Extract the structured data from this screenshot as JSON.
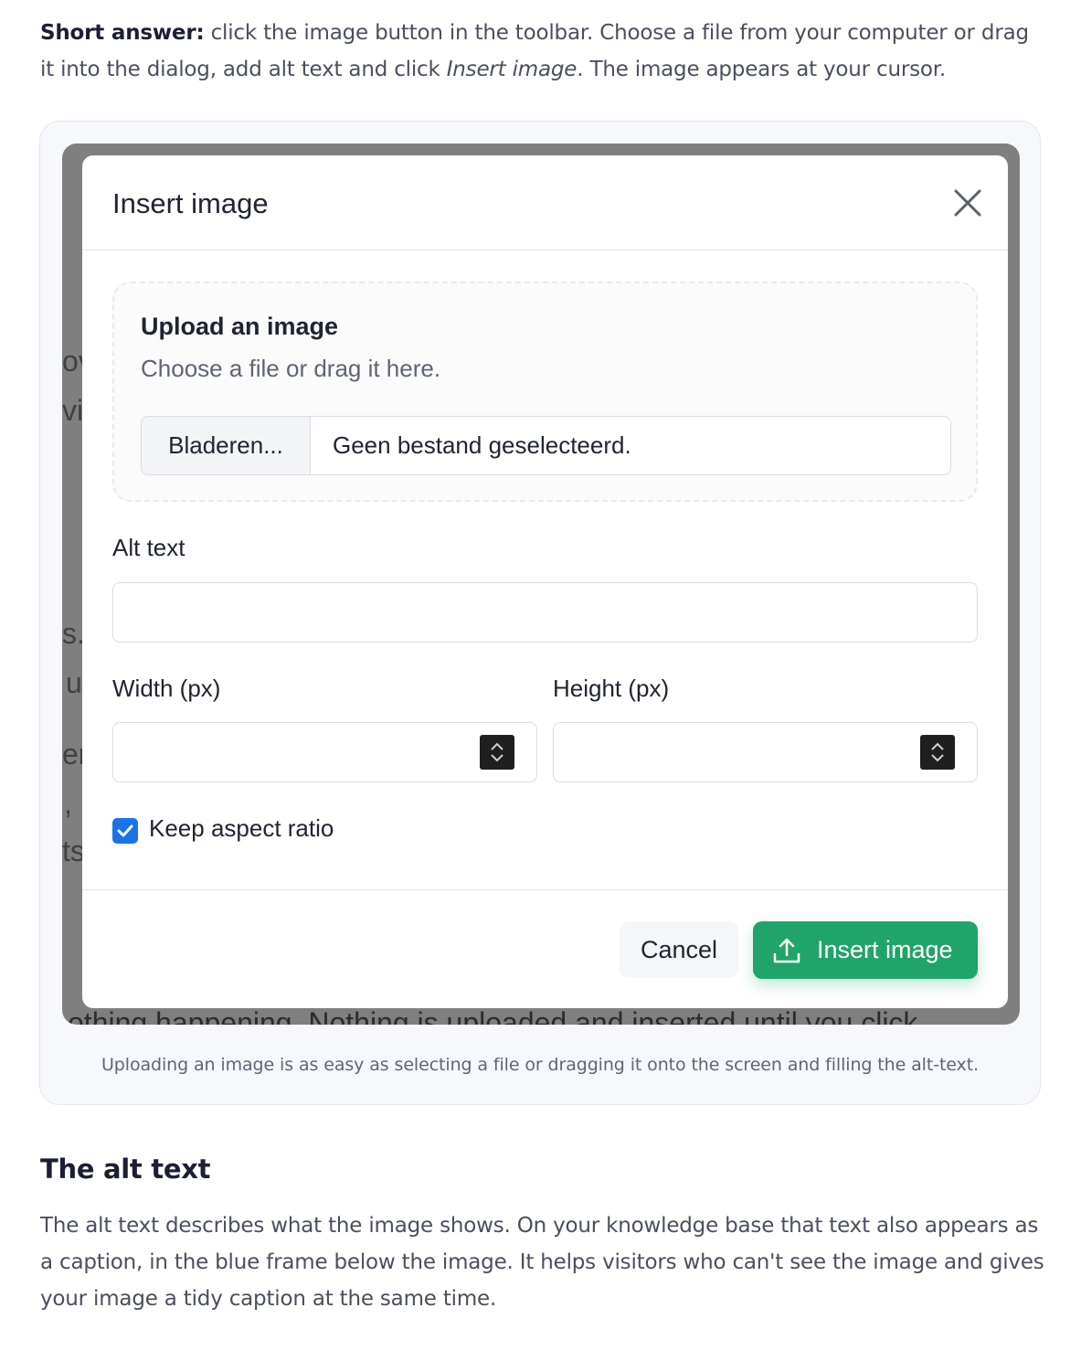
{
  "intro": {
    "lead": "Short answer:",
    "text_before": " click the image button in the toolbar. Choose a file from your computer or drag it into the dialog, add alt text and click ",
    "emphasis": "Insert image",
    "text_after": ". The image appears at your cursor."
  },
  "background_fragments": [
    "ov",
    "vi",
    "s.",
    "u",
    "er",
    ",",
    "ts"
  ],
  "background_bottom_text": "othing happening. Nothing is uploaded and inserted until you click",
  "dialog": {
    "title": "Insert image",
    "close_icon": "close-icon",
    "upload": {
      "title": "Upload an image",
      "hint": "Choose a file or drag it here.",
      "browse_label": "Bladeren...",
      "file_status": "Geen bestand geselecteerd."
    },
    "alt_text": {
      "label": "Alt text",
      "value": ""
    },
    "width": {
      "label": "Width (px)",
      "value": ""
    },
    "height": {
      "label": "Height (px)",
      "value": ""
    },
    "keep_aspect": {
      "label": "Keep aspect ratio",
      "checked": true
    },
    "cancel_label": "Cancel",
    "insert_label": "Insert image",
    "insert_icon": "upload-icon"
  },
  "caption": "Uploading an image is as easy as selecting a file or dragging it onto the screen and filling the alt-text.",
  "section": {
    "heading": "The alt text",
    "body": "The alt text describes what the image shows. On your knowledge base that text also appears as a caption, in the blue frame below the image. It helps visitors who can't see the image and gives your image a tidy caption at the same time."
  },
  "colors": {
    "accent_green": "#20a46a",
    "checkbox_blue": "#1a73e8",
    "heading": "#1c1f33",
    "body_text": "#4a4f5e"
  }
}
